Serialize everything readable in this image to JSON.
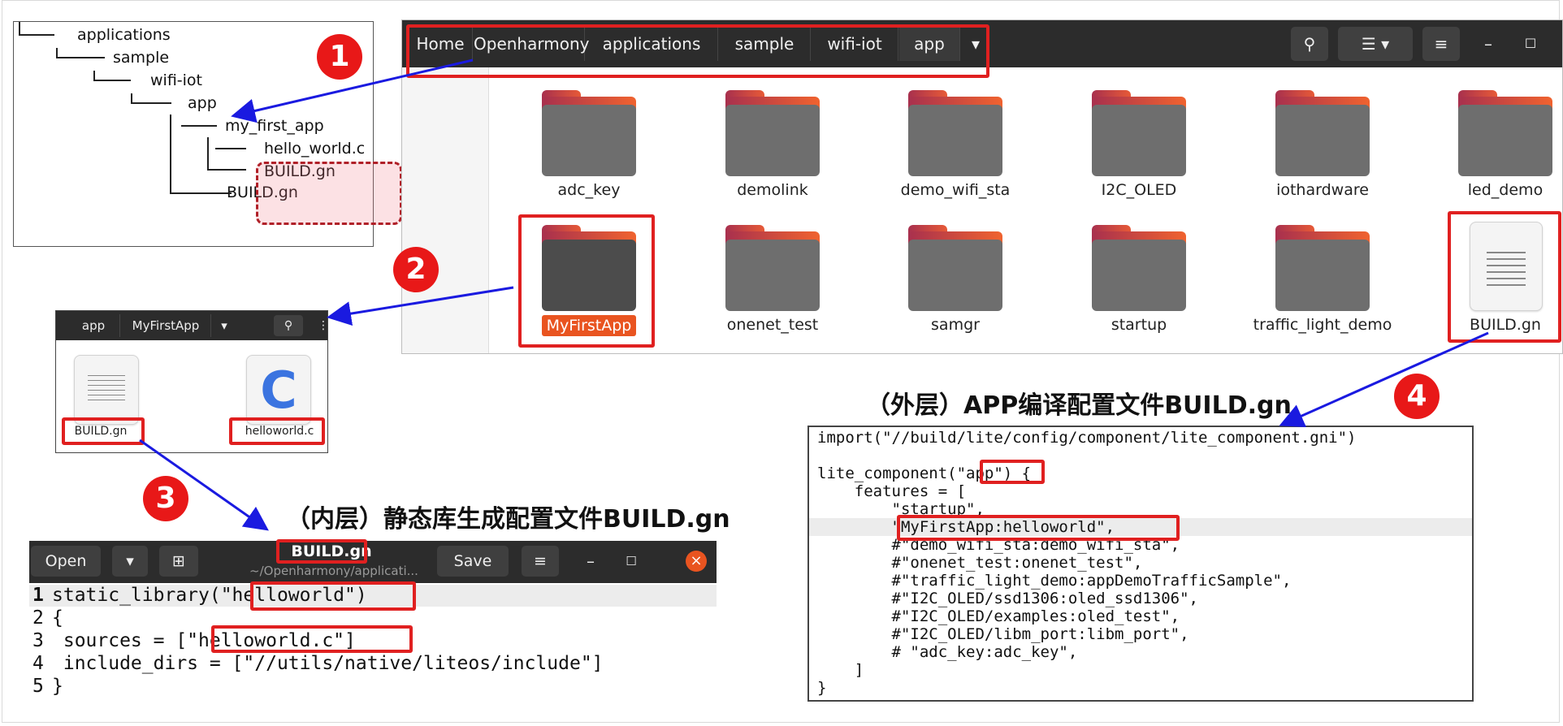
{
  "tree": {
    "lines": [
      "applications",
      "sample",
      "wifi-iot",
      "app",
      "my_first_app",
      "hello_world.c",
      "BUILD.gn",
      "BUILD.gn"
    ]
  },
  "file_manager": {
    "breadcrumbs": [
      "Home",
      "Openharmony",
      "applications",
      "sample",
      "wifi-iot",
      "app"
    ],
    "folders_row1": [
      "adc_key",
      "demolink",
      "demo_wifi_sta",
      "I2C_OLED",
      "iothardware",
      "led_demo"
    ],
    "folders_row2": [
      "MyFirstApp",
      "onenet_test",
      "samgr",
      "startup",
      "traffic_light_demo"
    ],
    "file": "BUILD.gn",
    "accent": "#e95420"
  },
  "small_window": {
    "crumbs": [
      "app",
      "MyFirstApp"
    ],
    "files": [
      "BUILD.gn",
      "helloworld.c"
    ],
    "c_letter": "C"
  },
  "editor": {
    "open_label": "Open",
    "title": "BUILD.gn",
    "path": "~/Openharmony/applicati...",
    "save_label": "Save",
    "line_numbers": [
      "1",
      "2",
      "3",
      "4",
      "5"
    ],
    "lines": [
      "static_library(\"helloworld\")",
      "{",
      " sources = [\"helloworld.c\"]",
      " include_dirs = [\"//utils/native/liteos/include\"]",
      "}"
    ]
  },
  "code_box": {
    "lines": [
      "import(\"//build/lite/config/component/lite_component.gni\")",
      "",
      "lite_component(\"app\") {",
      "    features = [",
      "        \"startup\",",
      "        \"MyFirstApp:helloworld\",",
      "        #\"demo_wifi_sta:demo_wifi_sta\",",
      "        #\"onenet_test:onenet_test\",",
      "        #\"traffic_light_demo:appDemoTrafficSample\",",
      "        #\"I2C_OLED/ssd1306:oled_ssd1306\",",
      "        #\"I2C_OLED/examples:oled_test\",",
      "        #\"I2C_OLED/libm_port:libm_port\",",
      "        # \"adc_key:adc_key\",",
      "    ]",
      "}"
    ]
  },
  "headings": {
    "outer": "（外层）APP编译配置文件BUILD.gn",
    "inner": "（内层）静态库生成配置文件BUILD.gn"
  },
  "badges": [
    "1",
    "2",
    "3",
    "4"
  ],
  "colors": {
    "highlight_red": "#e02020",
    "arrow_blue": "#1a1ae0",
    "badge_red": "#e81818"
  }
}
